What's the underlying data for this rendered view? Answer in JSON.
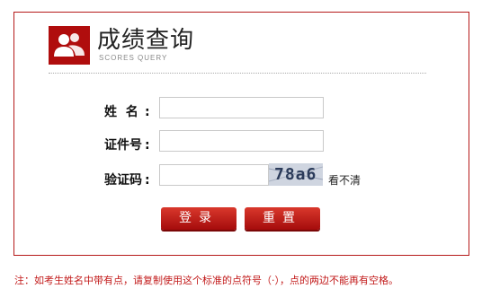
{
  "header": {
    "title": "成绩查询",
    "subtitle": "SCORES QUERY",
    "logo_icon": "users-icon",
    "accent_color": "#b00d0d"
  },
  "form": {
    "name_label": "姓  名",
    "id_label": "证件号",
    "captcha_label": "验证码",
    "colon": ":",
    "name_value": "",
    "id_value": "",
    "captcha_input_value": "",
    "captcha_text": "78a6",
    "refresh_link": "看不清"
  },
  "buttons": {
    "login": "登录",
    "reset": "重置"
  },
  "note": "注：如考生姓名中带有点，请复制使用这个标准的点符号（·），点的两边不能再有空格。"
}
